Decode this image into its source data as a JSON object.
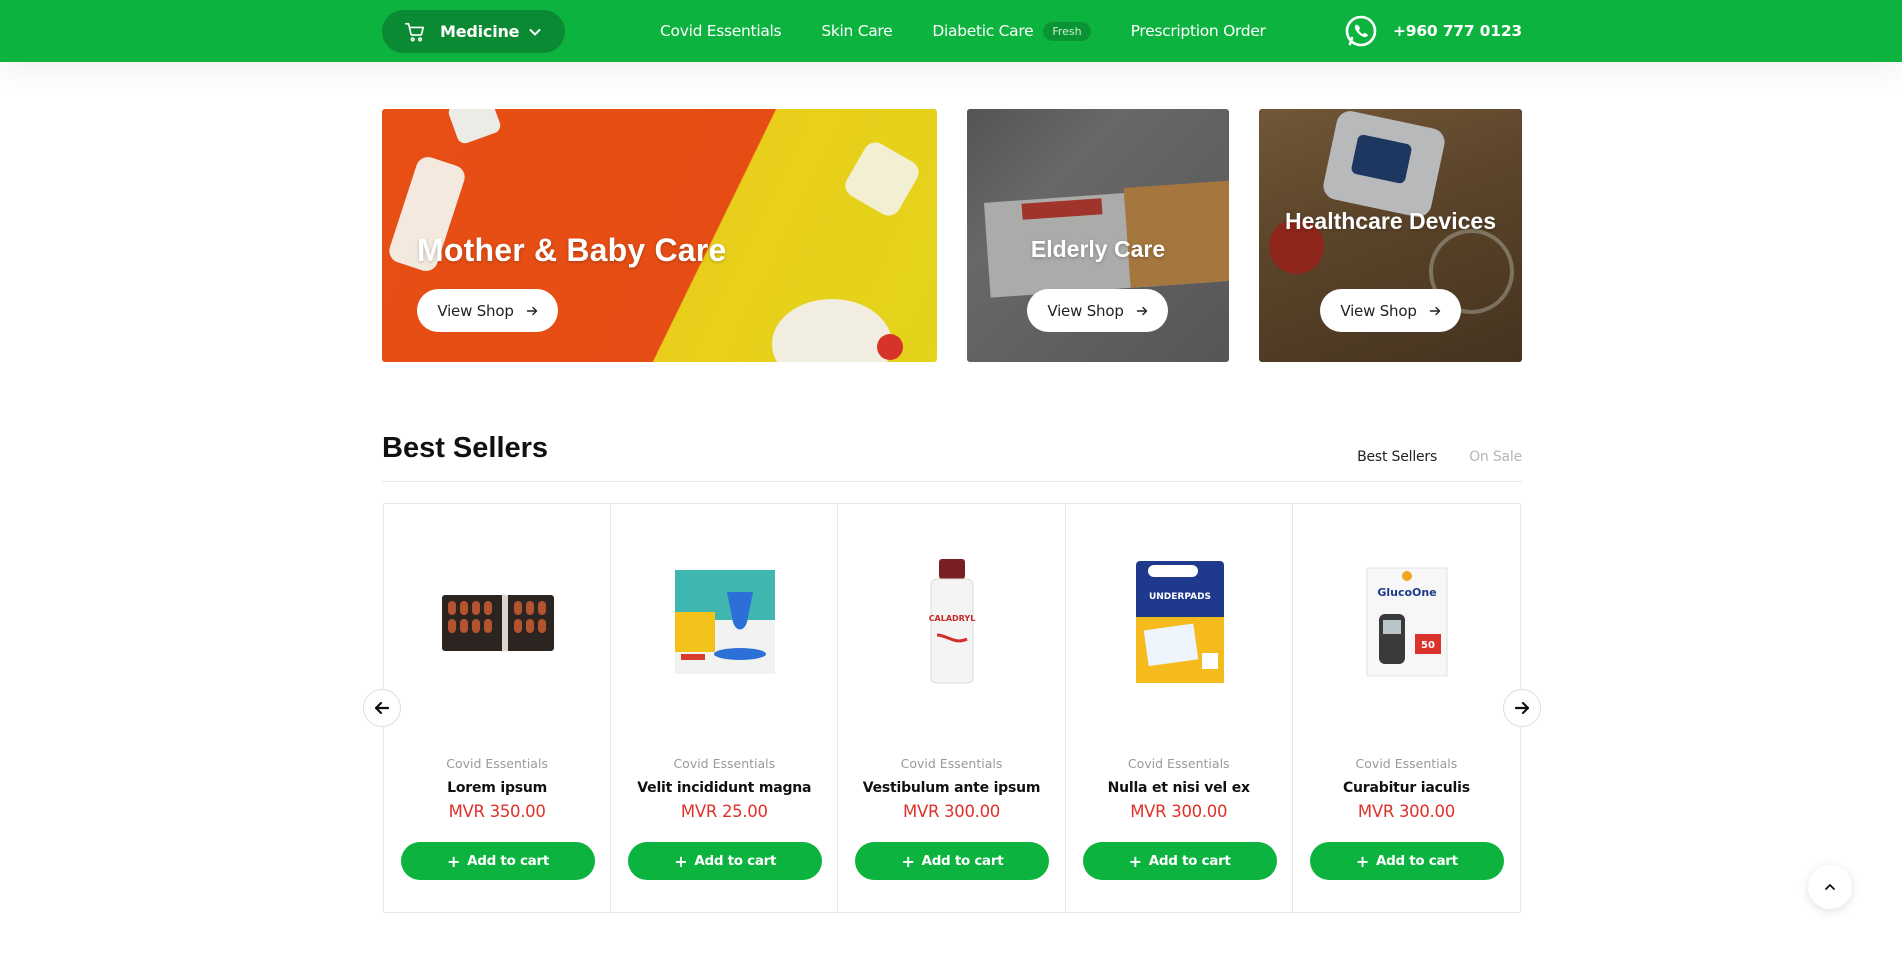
{
  "colors": {
    "brand_green": "#0db33f",
    "dark_green": "#0a8a33",
    "price_red": "#e0312a"
  },
  "header": {
    "category_button": {
      "label": "Medicine",
      "icon": "cart-icon",
      "chevron": "chevron-down-icon"
    },
    "nav": [
      {
        "label": "Covid Essentials"
      },
      {
        "label": "Skin Care"
      },
      {
        "label": "Diabetic Care",
        "badge": "Fresh"
      },
      {
        "label": "Prescription Order"
      }
    ],
    "phone": {
      "icon": "whatsapp-icon",
      "number": "+960 777 0123"
    }
  },
  "banners": [
    {
      "title": "Mother & Baby Care",
      "button": "View Shop"
    },
    {
      "title": "Elderly Care",
      "button": "View Shop"
    },
    {
      "title": "Healthcare Devices",
      "button": "View Shop"
    }
  ],
  "best_sellers": {
    "title": "Best Sellers",
    "tabs": [
      {
        "label": "Best Sellers",
        "active": true
      },
      {
        "label": "On Sale",
        "active": false
      }
    ],
    "products": [
      {
        "category": "Covid Essentials",
        "name": "Lorem ipsum",
        "price": "MVR 350.00",
        "button": "Add to cart",
        "image": "capsule-blister-pack"
      },
      {
        "category": "Covid Essentials",
        "name": "Velit incididunt magna",
        "price": "MVR 25.00",
        "button": "Add to cart",
        "image": "vaporizer-box"
      },
      {
        "category": "Covid Essentials",
        "name": "Vestibulum ante ipsum",
        "price": "MVR 300.00",
        "button": "Add to cart",
        "image": "caladryl-bottle"
      },
      {
        "category": "Covid Essentials",
        "name": "Nulla et nisi vel ex",
        "price": "MVR 300.00",
        "button": "Add to cart",
        "image": "underpads-pack"
      },
      {
        "category": "Covid Essentials",
        "name": "Curabitur iaculis",
        "price": "MVR 300.00",
        "button": "Add to cart",
        "image": "glucometer-box"
      }
    ],
    "nav_icons": {
      "prev": "arrow-left-icon",
      "next": "arrow-right-icon"
    }
  },
  "scroll_top": {
    "icon": "chevron-up-icon"
  }
}
